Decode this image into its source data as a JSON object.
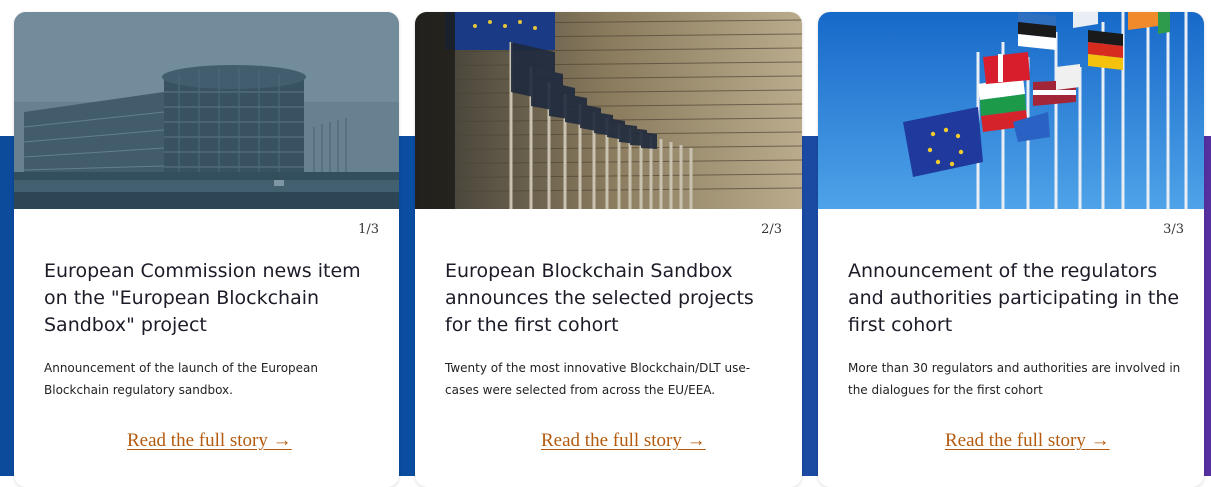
{
  "cards": [
    {
      "counter": "1/3",
      "title": "European Commission news item on the \"European Blockchain Sandbox\" project",
      "description": "Announcement of the launch of the European Blockchain regulatory sandbox.",
      "link_label": "Read the full story →"
    },
    {
      "counter": "2/3",
      "title": "European Blockchain Sandbox announces the selected projects for the first cohort",
      "description": "Twenty of the most innovative Blockchain/DLT use-cases were selected from across the EU/EEA.",
      "link_label": "Read the full story →"
    },
    {
      "counter": "3/3",
      "title": "Announcement of the regulators and authorities participating in the first cohort",
      "description": "More than 30 regulators and authorities are involved in the dialogues for the first cohort",
      "link_label": "Read the full story →"
    }
  ],
  "colors": {
    "band_start": "#0c4a9c",
    "band_end": "#5530a0",
    "link": "#b35a0e",
    "title": "#1c1c28"
  }
}
